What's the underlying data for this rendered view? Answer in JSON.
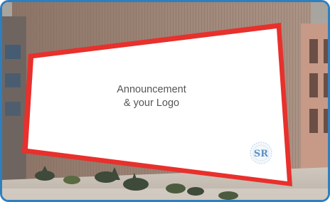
{
  "billboard": {
    "line1": "Announcement",
    "line2": "& your Logo",
    "logo_text": "SR",
    "frame_color": "#e8302c",
    "border_color": "#2e7fc0"
  },
  "icons": {
    "logo": "watermark-seal-icon"
  }
}
